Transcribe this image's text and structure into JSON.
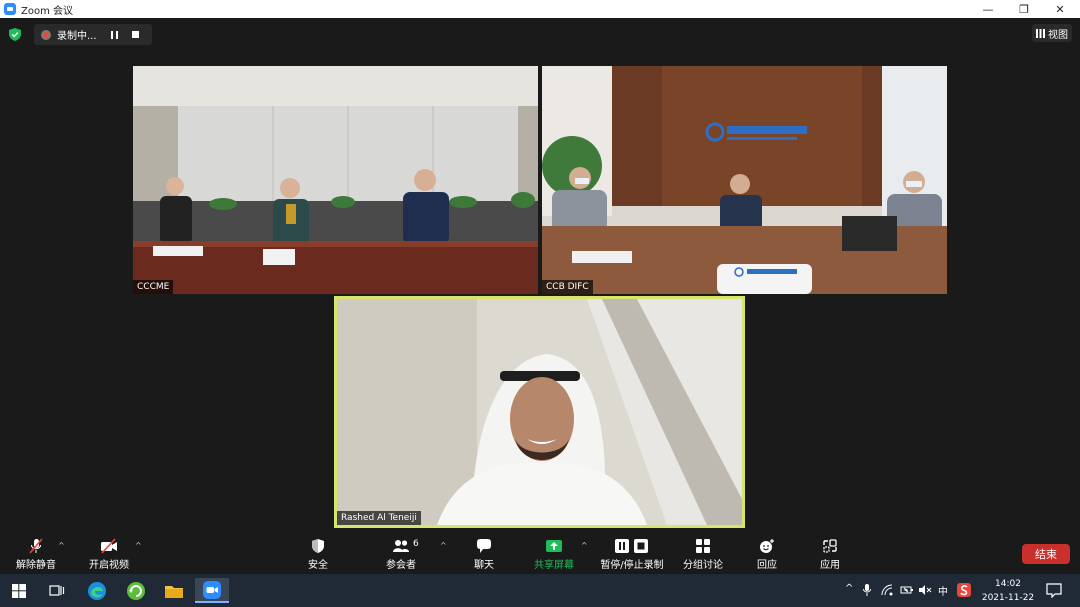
{
  "window": {
    "title": "Zoom 会议",
    "minimize": "—",
    "maximize": "❐",
    "close": "✕"
  },
  "recording": {
    "label": "录制中..."
  },
  "view": {
    "label": "视图"
  },
  "participants": [
    {
      "name": "CCCME"
    },
    {
      "name": "CCB DIFC"
    },
    {
      "name": "Rashed Al Teneiji"
    }
  ],
  "toolbar": {
    "unmute": "解除静音",
    "start_video": "开启视频",
    "security": "安全",
    "participants": "参会者",
    "participant_count": "6",
    "chat": "聊天",
    "share_screen": "共享屏幕",
    "pause_stop_recording": "暂停/停止录制",
    "breakout": "分组讨论",
    "reactions": "回应",
    "apps": "应用",
    "end": "结束"
  },
  "tray": {
    "ime": "中",
    "time": "14:02",
    "date": "2021-11-22"
  },
  "colors": {
    "active_speaker_border": "#d7e66a",
    "share_green": "#1fbd5a",
    "end_red": "#c9302c",
    "brand_blue": "#2d8cff"
  }
}
